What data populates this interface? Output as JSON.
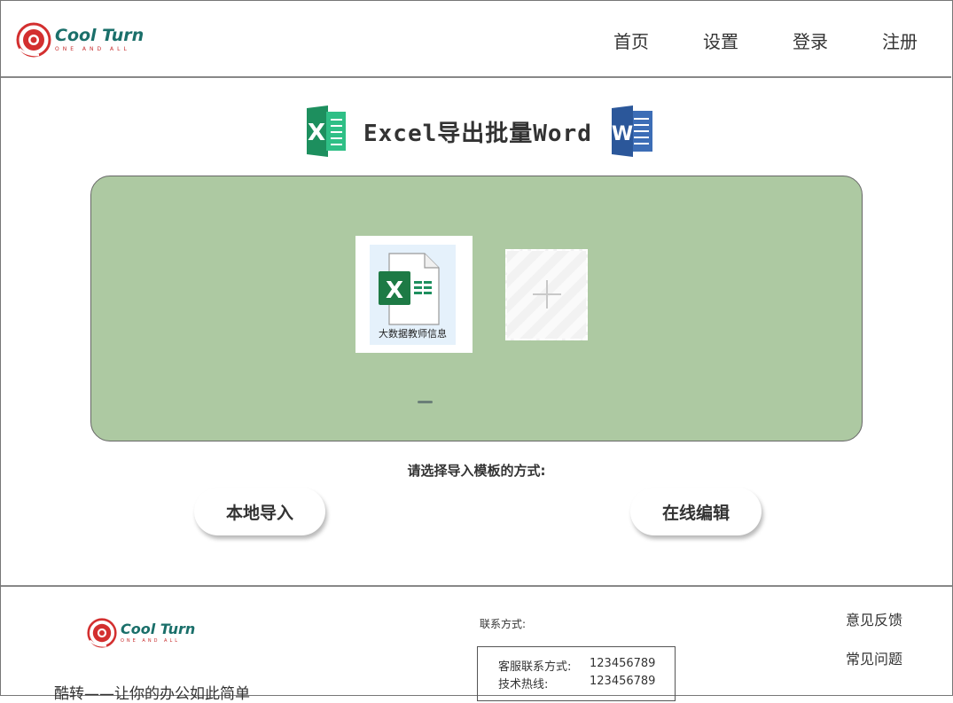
{
  "header": {
    "logo": {
      "name": "Cool Turn",
      "tagline": "ONE AND ALL"
    },
    "nav": [
      "首页",
      "设置",
      "登录",
      "注册"
    ]
  },
  "title": {
    "text": "Excel导出批量Word",
    "left_icon": "excel-icon",
    "right_icon": "word-icon"
  },
  "upload": {
    "file_name": "大数据教师信息",
    "file_icon": "excel-file-icon",
    "add_icon": "plus-icon"
  },
  "choose": {
    "label": "请选择导入模板的方式:",
    "local_button": "本地导入",
    "online_button": "在线编辑"
  },
  "footer": {
    "logo": {
      "name": "Cool Turn",
      "tagline": "ONE AND ALL"
    },
    "slogan": "酷转——让你的办公如此简单",
    "contact_title": "联系方式:",
    "contacts": [
      {
        "label": "客服联系方式:",
        "value": "123456789"
      },
      {
        "label": "技术热线:",
        "value": "123456789"
      }
    ],
    "links": [
      "意见反馈",
      "常见问题"
    ]
  },
  "colors": {
    "panel": "#adc9a2",
    "brand_teal": "#1a6f6a",
    "brand_red": "#c72b2b",
    "excel_green": "#1d8f5e",
    "word_blue": "#2b579a"
  }
}
